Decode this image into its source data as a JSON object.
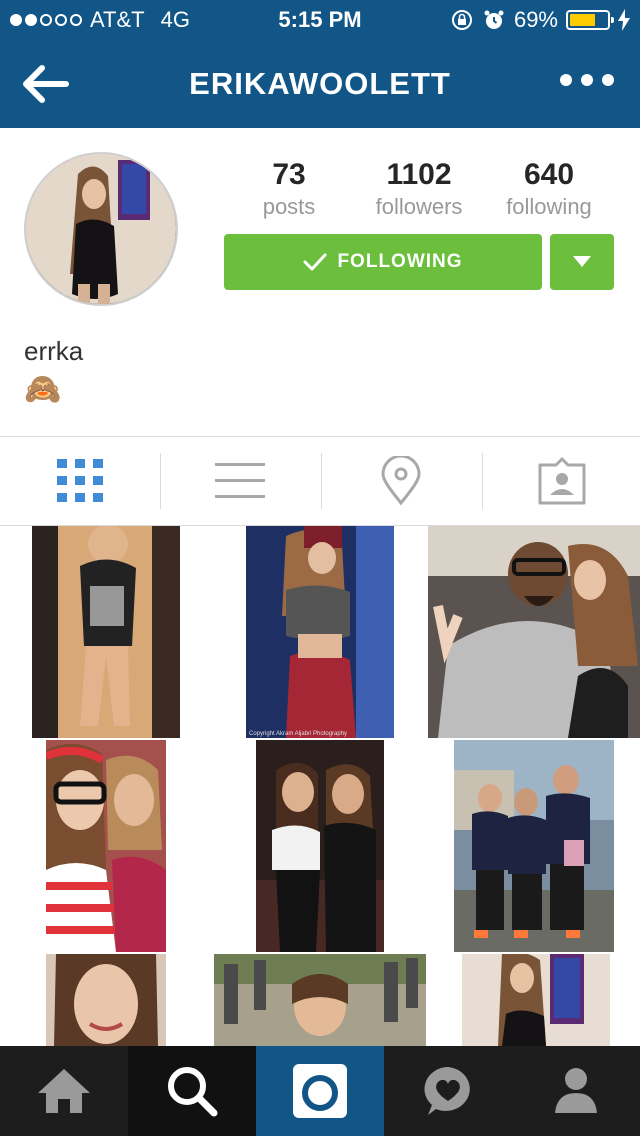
{
  "status_bar": {
    "carrier": "AT&T",
    "network": "4G",
    "time": "5:15 PM",
    "battery": "69%",
    "battery_level": 0.69,
    "icons": [
      "rotation-lock-icon",
      "alarm-icon",
      "battery-icon",
      "charging-icon"
    ]
  },
  "nav": {
    "title": "ERIKAWOOLETT",
    "back_icon": "back-arrow-icon",
    "more_icon": "more-dots-icon"
  },
  "profile": {
    "posts_count": "73",
    "posts_label": "posts",
    "followers_count": "1102",
    "followers_label": "followers",
    "following_count": "640",
    "following_label": "following",
    "follow_button_label": "FOLLOWING",
    "full_name": "errka",
    "bio": "🙈"
  },
  "tabs": [
    {
      "name": "grid-view",
      "icon": "grid-icon",
      "active": true
    },
    {
      "name": "list-view",
      "icon": "list-icon",
      "active": false
    },
    {
      "name": "map-view",
      "icon": "location-pin-icon",
      "active": false
    },
    {
      "name": "tagged-photos",
      "icon": "tagged-person-icon",
      "active": false
    }
  ],
  "photo_grid": [
    {
      "id": 1,
      "watermark": ""
    },
    {
      "id": 2,
      "watermark": "Copyright Akram Aljabri Photography"
    },
    {
      "id": 3,
      "watermark": ""
    },
    {
      "id": 4,
      "watermark": ""
    },
    {
      "id": 5,
      "watermark": ""
    },
    {
      "id": 6,
      "watermark": ""
    },
    {
      "id": 7,
      "watermark": ""
    },
    {
      "id": 8,
      "watermark": ""
    },
    {
      "id": 9,
      "watermark": ""
    }
  ],
  "tab_bar": [
    {
      "name": "home",
      "icon": "home-icon",
      "active": false
    },
    {
      "name": "explore",
      "icon": "search-icon",
      "active": true
    },
    {
      "name": "camera",
      "icon": "camera-icon",
      "active": false
    },
    {
      "name": "activity",
      "icon": "heart-bubble-icon",
      "active": false
    },
    {
      "name": "profile",
      "icon": "profile-icon",
      "active": false
    }
  ],
  "colors": {
    "header_blue": "#125688",
    "follow_green": "#6bbf3c",
    "tab_active_blue": "#3f8bd6",
    "tabbar_bg": "#1d1d1d",
    "camera_tab_bg": "#125688"
  }
}
